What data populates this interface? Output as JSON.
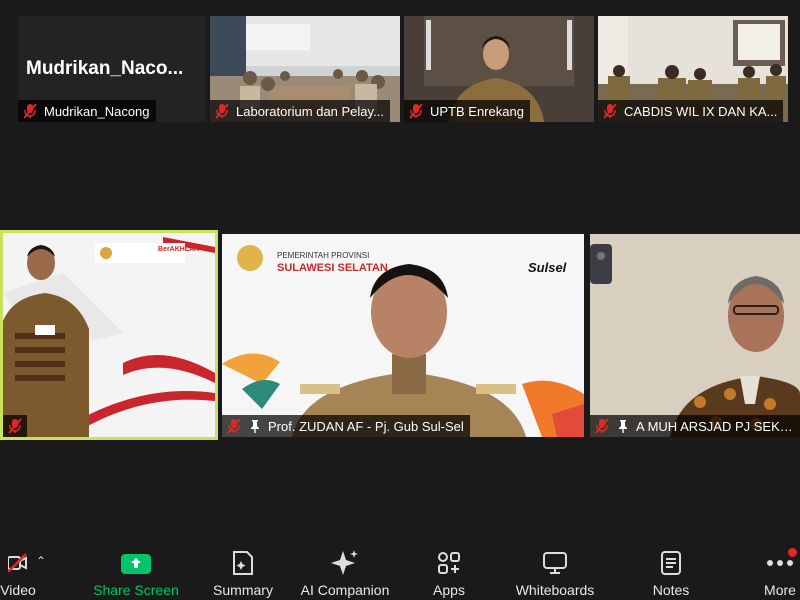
{
  "participants_top": [
    {
      "name": "Mudrikan_Nacong",
      "big_name": "Mudrikan_Naco...",
      "muted": true
    },
    {
      "name": "Laboratorium dan Pelay...",
      "muted": true
    },
    {
      "name": "UPTB Enrekang",
      "muted": true
    },
    {
      "name": "CABDIS WIL IX DAN KA...",
      "muted": true
    }
  ],
  "participants_bottom": [
    {
      "name": "",
      "muted": true,
      "active_speaker": true,
      "banner_left": "BerAKHLAK"
    },
    {
      "name": "Prof. ZUDAN AF - Pj. Gub Sul-Sel",
      "muted": true,
      "pinned": true,
      "banner_line1": "PEMERINTAH PROVINSI",
      "banner_line2": "SULAWESI SELATAN",
      "logo_text": "Sulsel"
    },
    {
      "name": "A MUH ARSJAD PJ SEKDA",
      "muted": true,
      "pinned": true
    }
  ],
  "toolbar": {
    "video": "Video",
    "share": "Share Screen",
    "summary": "Summary",
    "ai": "AI Companion",
    "apps": "Apps",
    "whiteboards": "Whiteboards",
    "notes": "Notes",
    "more": "More"
  },
  "colors": {
    "active_speaker_border": "#c7e35a",
    "share_green": "#00c46a",
    "muted_red": "#e02828"
  }
}
